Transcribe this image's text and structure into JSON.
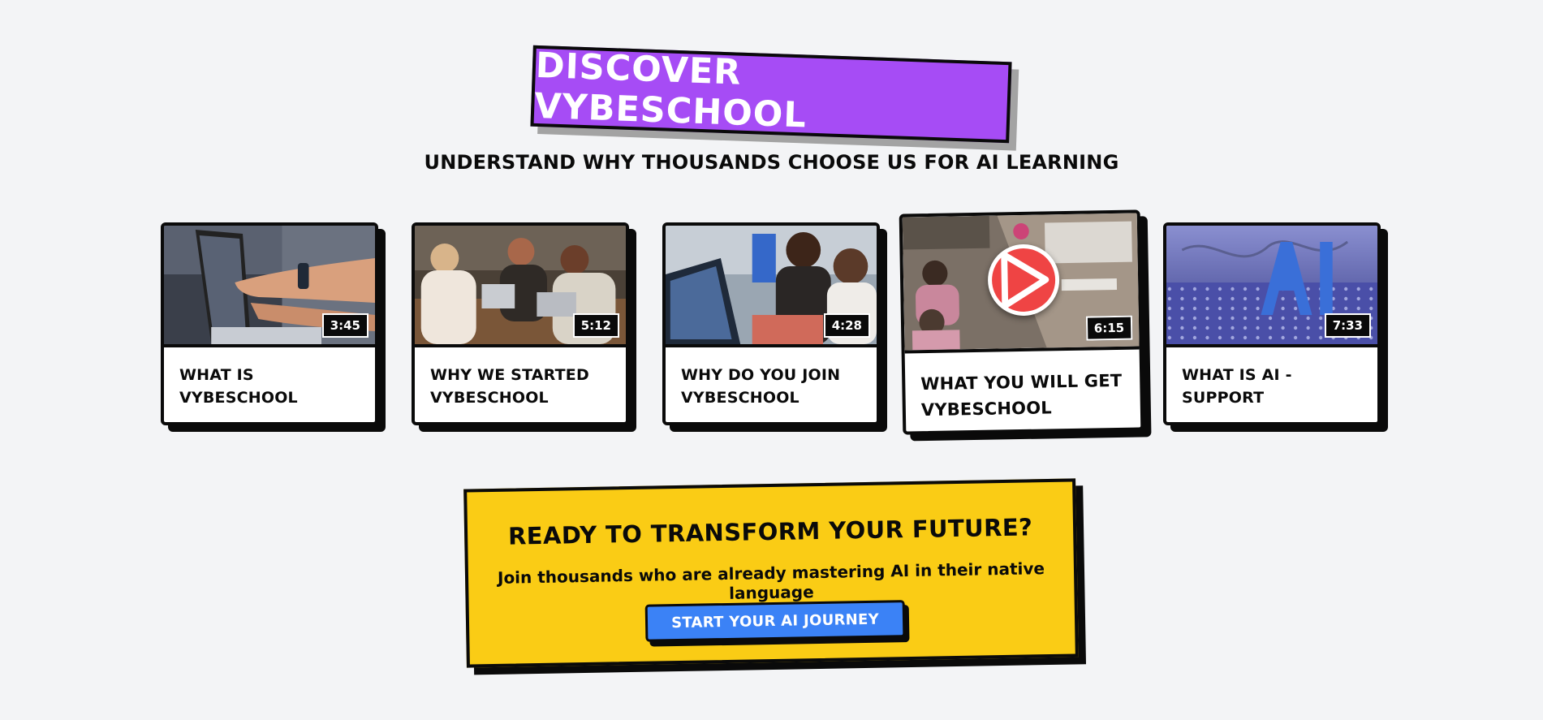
{
  "hero": {
    "title": "DISCOVER VYBESCHOOL",
    "subtitle": "UNDERSTAND WHY THOUSANDS CHOOSE US FOR AI LEARNING"
  },
  "videos": [
    {
      "title": "WHAT IS VYBESCHOOL",
      "duration": "3:45",
      "thumbnail": "laptop-pointing"
    },
    {
      "title": "WHY WE STARTED VYBESCHOOL",
      "duration": "5:12",
      "thumbnail": "friends-with-laptops"
    },
    {
      "title": "WHY DO YOU JOIN VYBESCHOOL",
      "duration": "4:28",
      "thumbnail": "students-at-computers"
    },
    {
      "title": "WHAT YOU WILL GET VYBESCHOOL",
      "duration": "6:15",
      "thumbnail": "overhead-office",
      "featured": true,
      "play_icon": "play-icon"
    },
    {
      "title": "WHAT IS AI - SUPPORT",
      "duration": "7:33",
      "thumbnail": "ai-3d-letters"
    }
  ],
  "cta": {
    "title": "READY TO TRANSFORM YOUR FUTURE?",
    "subtitle": "Join thousands who are already mastering AI in their native language",
    "button_label": "START YOUR AI JOURNEY"
  },
  "colors": {
    "background": "#f3f4f6",
    "hero_purple": "#a64cf5",
    "cta_yellow": "#facc15",
    "button_blue": "#3b82f6",
    "play_red": "#ef4444",
    "ink": "#0a0a0a"
  }
}
